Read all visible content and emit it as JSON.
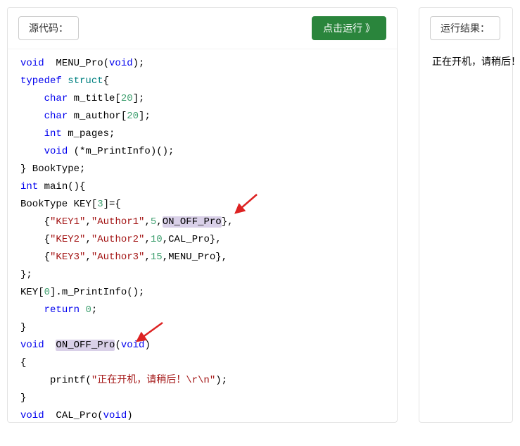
{
  "left": {
    "source_label": "源代码：",
    "run_label": "点击运行 》"
  },
  "right": {
    "result_label": "运行结果：",
    "output": "正在开机，请稍后！"
  },
  "code": {
    "l1a": "void",
    "l1b": "  MENU_Pro(",
    "l1c": "void",
    "l1d": ");",
    "l2a": "typedef",
    "l2b": "struct",
    "l2c": "{",
    "l3a": "    ",
    "l3b": "char",
    "l3c": " m_title[",
    "l3d": "20",
    "l3e": "];",
    "l4a": "    ",
    "l4b": "char",
    "l4c": " m_author[",
    "l4d": "20",
    "l4e": "];",
    "l5a": "    ",
    "l5b": "int",
    "l5c": " m_pages;",
    "l6a": "    ",
    "l6b": "void",
    "l6c": " (*m_PrintInfo)();",
    "l7": "} BookType;",
    "l8a": "int",
    "l8b": " main(){",
    "l9a": "BookType KEY[",
    "l9b": "3",
    "l9c": "]={",
    "l10a": "    {",
    "l10b": "\"KEY1\"",
    "l10c": ",",
    "l10d": "\"Author1\"",
    "l10e": ",",
    "l10f": "5",
    "l10g": ",",
    "l10h": "ON_OFF_Pro",
    "l10i": "},",
    "l11a": "    {",
    "l11b": "\"KEY2\"",
    "l11c": ",",
    "l11d": "\"Author2\"",
    "l11e": ",",
    "l11f": "10",
    "l11g": ",CAL_Pro},",
    "l12a": "    {",
    "l12b": "\"KEY3\"",
    "l12c": ",",
    "l12d": "\"Author3\"",
    "l12e": ",",
    "l12f": "15",
    "l12g": ",MENU_Pro},",
    "l13": "};",
    "l14a": "KEY[",
    "l14b": "0",
    "l14c": "].m_PrintInfo();",
    "l15a": "    ",
    "l15b": "return",
    "l15c": " ",
    "l15d": "0",
    "l15e": ";",
    "l16": "}",
    "l17a": "void",
    "l17b": "  ",
    "l17c": "ON_OFF_Pro",
    "l17d": "(",
    "l17e": "void",
    "l17f": ")",
    "l18": "{",
    "l19a": "     printf(",
    "l19b": "\"正在开机，请稍后！\\r\\n\"",
    "l19c": ");",
    "l20": "}",
    "l21a": "void",
    "l21b": "  CAL_Pro(",
    "l21c": "void",
    "l21d": ")"
  }
}
